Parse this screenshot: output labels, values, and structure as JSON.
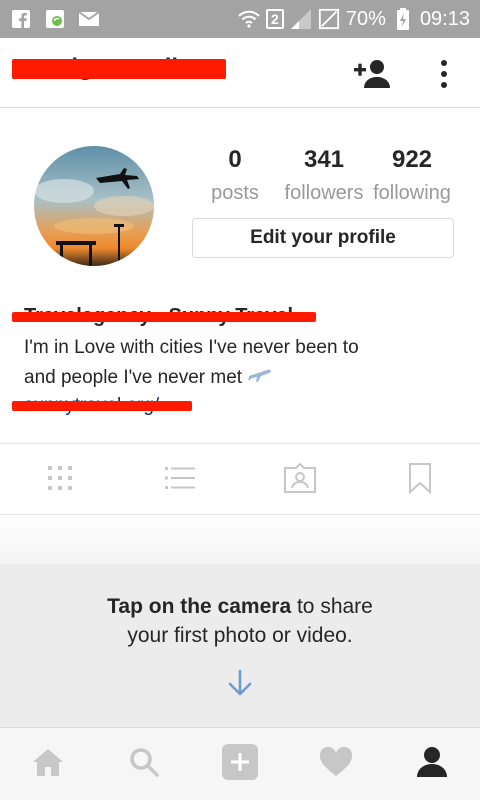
{
  "status_bar": {
    "battery": "70%",
    "time": "09:13",
    "sim_slot": "2"
  },
  "header": {
    "username": "travelgramnellos"
  },
  "profile": {
    "stats": [
      {
        "value": "0",
        "label": "posts"
      },
      {
        "value": "341",
        "label": "followers"
      },
      {
        "value": "922",
        "label": "following"
      }
    ],
    "edit_button": "Edit your profile",
    "full_name": "Travelagency - Sunny Travel",
    "bio_lines": [
      "I'm in Love with cities I've never been to",
      "and people I've never met"
    ],
    "website": "sunnytravel.org/"
  },
  "empty_state": {
    "bold": "Tap on the camera",
    "rest": " to share",
    "line2": "your first photo or video."
  },
  "colors": {
    "status_bar": "#a3a3a3",
    "redaction": "#ff1a00",
    "nav_icon_inactive": "#c7c7c7",
    "nav_icon_active": "#262626",
    "hint_arrow": "#6c9bd2"
  },
  "icons": {
    "tabs": [
      "grid-icon",
      "list-icon",
      "tagged-photos-icon",
      "bookmark-icon"
    ],
    "nav": [
      "home-icon",
      "search-icon",
      "add-icon",
      "heart-icon",
      "profile-icon"
    ]
  }
}
